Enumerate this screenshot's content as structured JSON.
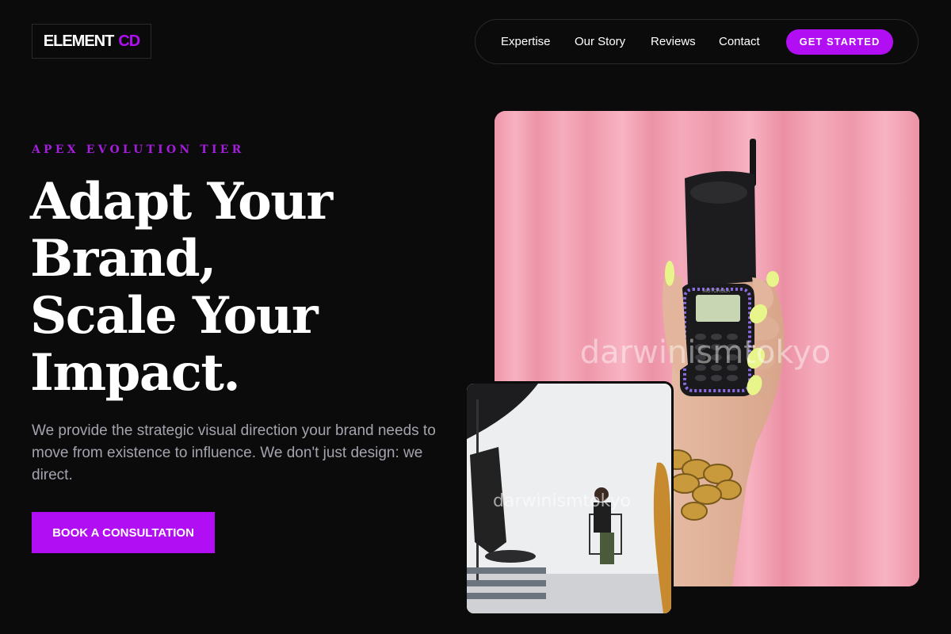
{
  "logo": {
    "text": "ELEMENT",
    "accent": "CD"
  },
  "nav": {
    "links": [
      "Expertise",
      "Our Story",
      "Reviews",
      "Contact"
    ],
    "cta_label": "GET STARTED"
  },
  "hero": {
    "eyebrow": "APEX EVOLUTION TIER",
    "headline_lines": [
      "Adapt Your",
      "Brand,",
      "Scale Your",
      "Impact."
    ],
    "lead": "We provide the strategic visual direction your brand needs to move from existence to influence. We don't just design: we direct.",
    "button_label": "BOOK A CONSULTATION"
  },
  "images": {
    "main": {
      "watermark": "darwinismtokyo",
      "phone_brand": "MOTOROLA"
    },
    "inset": {
      "watermark": "darwinismtokyo"
    }
  },
  "colors": {
    "accent": "#b20ef4",
    "background": "#0c0b0c",
    "eyebrow": "#a41ddc",
    "body_text": "#a3a4ad",
    "curtain_pink": "#f29fb2",
    "nail_yellow": "#e8f58a"
  }
}
